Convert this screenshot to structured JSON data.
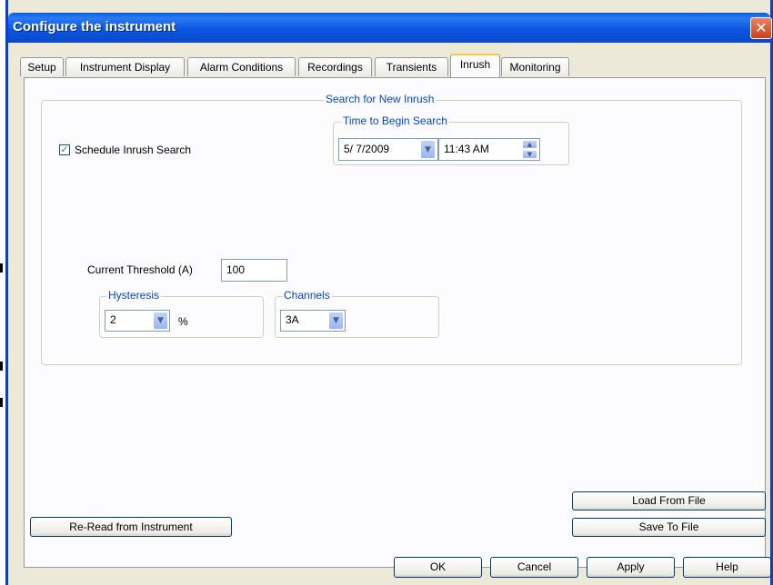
{
  "window": {
    "title": "Configure the instrument",
    "close_glyph": "✕"
  },
  "tabs": [
    {
      "label": "Setup"
    },
    {
      "label": "Instrument Display"
    },
    {
      "label": "Alarm Conditions"
    },
    {
      "label": "Recordings"
    },
    {
      "label": "Transients"
    },
    {
      "label": "Inrush",
      "active": true
    },
    {
      "label": "Monitoring"
    }
  ],
  "inrush": {
    "search_group_label": "Search for New Inrush",
    "schedule_label": "Schedule Inrush Search",
    "schedule_checked": true,
    "time_group_label": "Time to Begin Search",
    "date_value": "5/ 7/2009",
    "time_value": "11:43 AM",
    "threshold_label": "Current Threshold (A)",
    "threshold_value": "100",
    "hysteresis_label": "Hysteresis",
    "hysteresis_value": "2",
    "hysteresis_unit": "%",
    "channels_label": "Channels",
    "channels_value": "3A"
  },
  "buttons": {
    "reread": "Re-Read from Instrument",
    "load": "Load From File",
    "save": "Save To File",
    "ok": "OK",
    "cancel": "Cancel",
    "apply": "Apply",
    "help": "Help"
  },
  "icons": {
    "check": "✓",
    "dropdown": "▼",
    "spin_up": "▲",
    "spin_down": "▼"
  },
  "colors": {
    "titlebar": "#0b56e0",
    "group_label": "#0046d5",
    "tab_highlight": "#ffc83c"
  }
}
